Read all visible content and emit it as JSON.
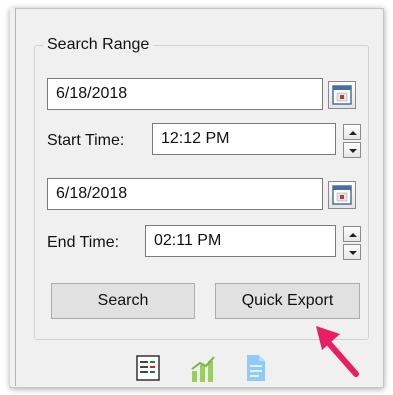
{
  "search_range": {
    "title": "Search Range",
    "start_date": "6/18/2018",
    "start_time_label": "Start Time:",
    "start_time": "12:12 PM",
    "end_date": "6/18/2018",
    "end_time_label": "End Time:",
    "end_time": "02:11 PM"
  },
  "buttons": {
    "search": "Search",
    "quick_export": "Quick Export"
  },
  "toolbar": {
    "icons": [
      "list-view-icon",
      "chart-icon",
      "document-icon"
    ]
  },
  "annotation": {
    "arrow_color": "#e91e63"
  }
}
